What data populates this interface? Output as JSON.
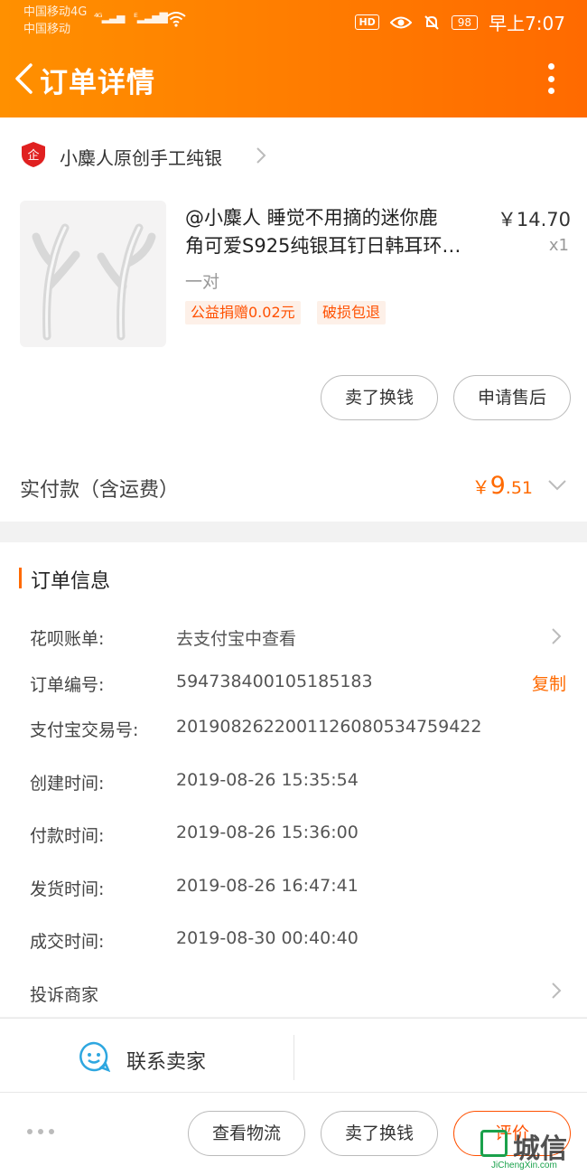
{
  "status_bar": {
    "carrier1": "中国移动4G",
    "carrier2": "中国移动",
    "signal1": "⁴ᴳ",
    "signal2": "ᴱ",
    "hd": "HD",
    "battery": "98",
    "time": "早上7:07"
  },
  "header": {
    "title": "订单详情",
    "bg_from": "#ff9000",
    "bg_to": "#ff6a00"
  },
  "shop": {
    "logo_text": "企",
    "name": "小麋人原创手工纯银"
  },
  "product": {
    "title_line1": "@小麋人 睡觉不用摘的迷你鹿",
    "title_line2": "角可爱S925纯银耳钉日韩耳环…",
    "price": "￥14.70",
    "quantity": "x1",
    "sku": "一对",
    "tags": [
      "公益捐赠0.02元",
      "破损包退"
    ]
  },
  "item_actions": {
    "sell_label": "卖了换钱",
    "after_sale_label": "申请售后"
  },
  "payment": {
    "label": "实付款（含运费）",
    "currency": "￥",
    "amount_int": "9",
    "amount_dec": ".51"
  },
  "order_info": {
    "section_title": "订单信息",
    "huabei_label": "花呗账单:",
    "huabei_value": "去支付宝中查看",
    "order_no_label": "订单编号:",
    "order_no_value": "594738400105185183",
    "copy_label": "复制",
    "alipay_label": "支付宝交易号:",
    "alipay_value": "2019082622001126080534759422",
    "created_label": "创建时间:",
    "created_value": "2019-08-26 15:35:54",
    "paid_label": "付款时间:",
    "paid_value": "2019-08-26 15:36:00",
    "shipped_label": "发货时间:",
    "shipped_value": "2019-08-26 16:47:41",
    "done_label": "成交时间:",
    "done_value": "2019-08-30 00:40:40",
    "complaint_label": "投诉商家"
  },
  "contact": {
    "label": "联系卖家"
  },
  "bottom_actions": {
    "logistics_label": "查看物流",
    "sell_label": "卖了换钱",
    "review_label": "评价"
  },
  "watermark": {
    "text": "城信",
    "url": "JiChengXin.com"
  },
  "colors": {
    "accent": "#ff6a00",
    "tag_bg": "#fdf0e8",
    "shop_red": "#e02020"
  }
}
